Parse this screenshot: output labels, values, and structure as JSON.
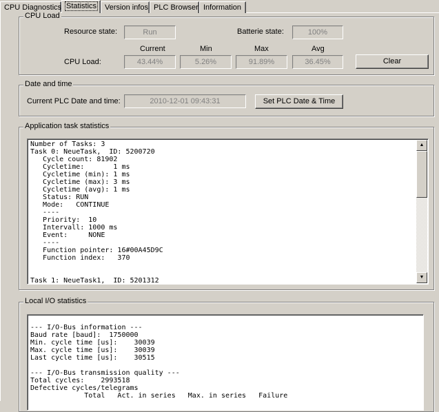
{
  "tabs": [
    {
      "label": "CPU Diagnostics"
    },
    {
      "label": "Statistics",
      "active": true
    },
    {
      "label": "Version infos"
    },
    {
      "label": "PLC Browser"
    },
    {
      "label": "Information"
    }
  ],
  "cpu_load": {
    "title": "CPU Load",
    "resource_state_label": "Resource state:",
    "resource_state": "Run",
    "batterie_state_label": "Batterie state:",
    "batterie_state": "100%",
    "headers": {
      "current": "Current",
      "min": "Min",
      "max": "Max",
      "avg": "Avg"
    },
    "cpu_load_label": "CPU Load:",
    "current": "43.44%",
    "min": "5.26%",
    "max": "91.89%",
    "avg": "36.45%",
    "clear_label": "Clear"
  },
  "date_time": {
    "title": "Date and time",
    "label": "Current PLC Date and time:",
    "value": "2010-12-01 09:43:31",
    "set_label": "Set PLC Date & Time"
  },
  "app_tasks": {
    "title": "Application task statistics",
    "text": "Number of Tasks: 3\nTask 0: NeueTask,  ID: 5200720\n   Cycle count: 81902\n   Cycletime:       1 ms\n   Cycletime (min): 1 ms\n   Cycletime (max): 3 ms\n   Cycletime (avg): 1 ms\n   Status: RUN\n   Mode:   CONTINUE\n   ----\n   Priority:  10\n   Intervall: 1000 ms\n   Event:     NONE\n   ----\n   Function pointer: 16#00A45D9C\n   Function index:   370\n\n\nTask 1: NeueTask1,  ID: 5201312"
  },
  "local_io": {
    "title": "Local I/O statistics",
    "text": "\n--- I/O-Bus information ---\nBaud rate [baud]:  1750000\nMin. cycle time [us]:    30039\nMax. cycle time [us]:    30039\nLast cycle time [us]:    30515\n\n--- I/O-Bus transmission quality ---\nTotal cycles:    2993518\nDefective cycles/telegrams\n             Total   Act. in series   Max. in series   Failure"
  },
  "icons": {
    "scroll_up": "arrow-up-icon",
    "scroll_down": "arrow-down-icon"
  }
}
